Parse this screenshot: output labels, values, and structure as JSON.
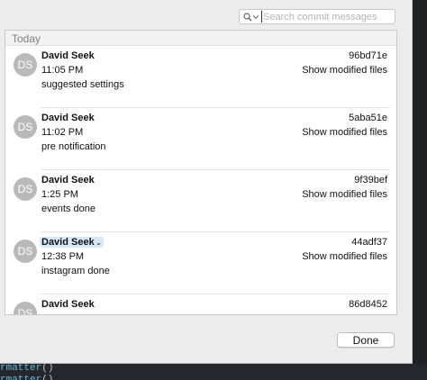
{
  "search": {
    "placeholder": "Search commit messages"
  },
  "list": {
    "section_header": "Today",
    "commits": [
      {
        "avatar": "DS",
        "author": "David Seek",
        "time": "11:05 PM",
        "message": "suggested settings",
        "hash": "96bd71e",
        "show_files": "Show modified files"
      },
      {
        "avatar": "DS",
        "author": "David Seek",
        "time": "11:02 PM",
        "message": "pre notification",
        "hash": "5aba51e",
        "show_files": "Show modified files"
      },
      {
        "avatar": "DS",
        "author": "David Seek",
        "time": "1:25 PM",
        "message": "events done",
        "hash": "9f39bef",
        "show_files": "Show modified files"
      },
      {
        "avatar": "DS",
        "author": "David Seek",
        "time": "12:38 PM",
        "message": "instagram done",
        "hash": "44adf37",
        "show_files": "Show modified files"
      },
      {
        "avatar": "DS",
        "author": "David Seek",
        "time": "",
        "message": "",
        "hash": "86d8452",
        "show_files": ""
      }
    ]
  },
  "footer": {
    "done_label": "Done"
  },
  "editor": {
    "line1_fn": "rmatter",
    "line1_rest": "()",
    "line2_fn": "rmatter",
    "line2_rest": "()"
  },
  "colors": {
    "selection": "#d9e9fb",
    "avatar": "#b9b9b9",
    "sheet": "#ececec"
  }
}
